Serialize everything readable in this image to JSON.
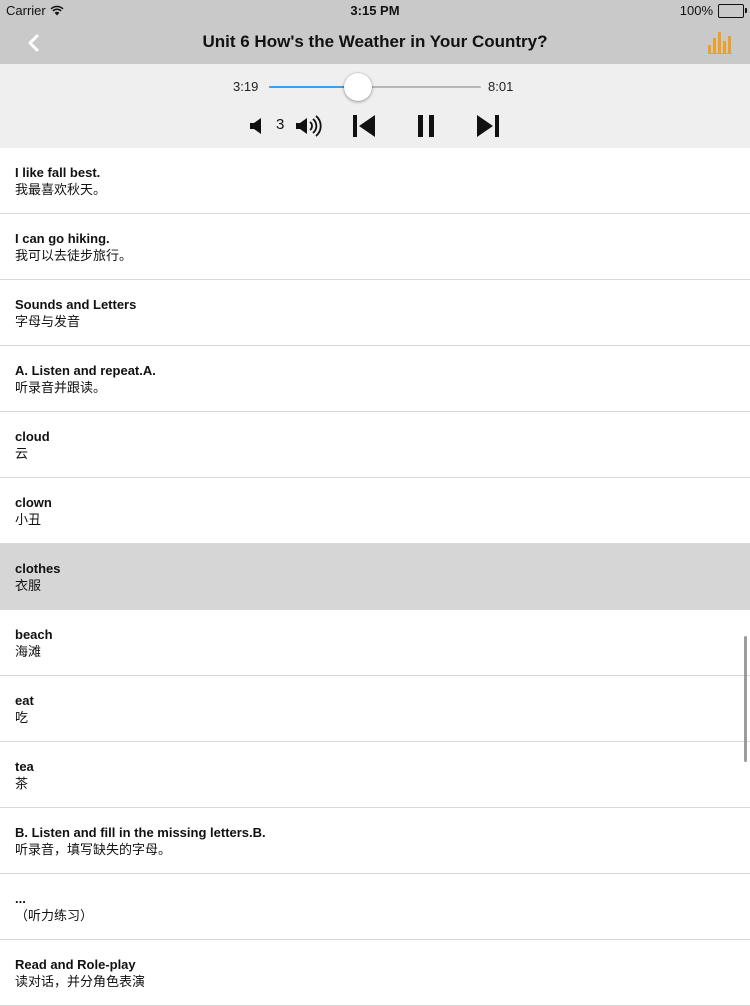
{
  "status_bar": {
    "carrier": "Carrier",
    "time": "3:15 PM",
    "battery": "100%"
  },
  "nav": {
    "title": "Unit 6 How's the Weather in Your Country?",
    "back_icon": "chevron-left-icon",
    "right_icon": "equalizer-bars-icon",
    "accent_color": "#f0a020"
  },
  "player": {
    "current_time": "3:19",
    "total_time": "8:01",
    "progress": 0.42,
    "volume_level": "3",
    "progress_color": "#3d9ff0"
  },
  "sentences": [
    {
      "en": "I like fall best.",
      "zh": "我最喜欢秋天。",
      "selected": false
    },
    {
      "en": "I can go hiking.",
      "zh": "我可以去徒步旅行。",
      "selected": false
    },
    {
      "en": "Sounds and Letters",
      "zh": "字母与发音",
      "selected": false
    },
    {
      "en": "A. Listen and repeat.A.",
      "zh": "听录音并跟读。",
      "selected": false
    },
    {
      "en": "cloud",
      "zh": "云",
      "selected": false
    },
    {
      "en": "clown",
      "zh": "小丑",
      "selected": false
    },
    {
      "en": "clothes",
      "zh": "衣服",
      "selected": true
    },
    {
      "en": "beach",
      "zh": "海滩",
      "selected": false
    },
    {
      "en": "eat",
      "zh": "吃",
      "selected": false
    },
    {
      "en": "tea",
      "zh": "茶",
      "selected": false
    },
    {
      "en": "B. Listen and fill in the missing letters.B.",
      "zh": "听录音，填写缺失的字母。",
      "selected": false
    },
    {
      "en": "...",
      "zh": "（听力练习）",
      "selected": false
    },
    {
      "en": "Read and Role-play",
      "zh": "读对话，并分角色表演",
      "selected": false
    }
  ]
}
